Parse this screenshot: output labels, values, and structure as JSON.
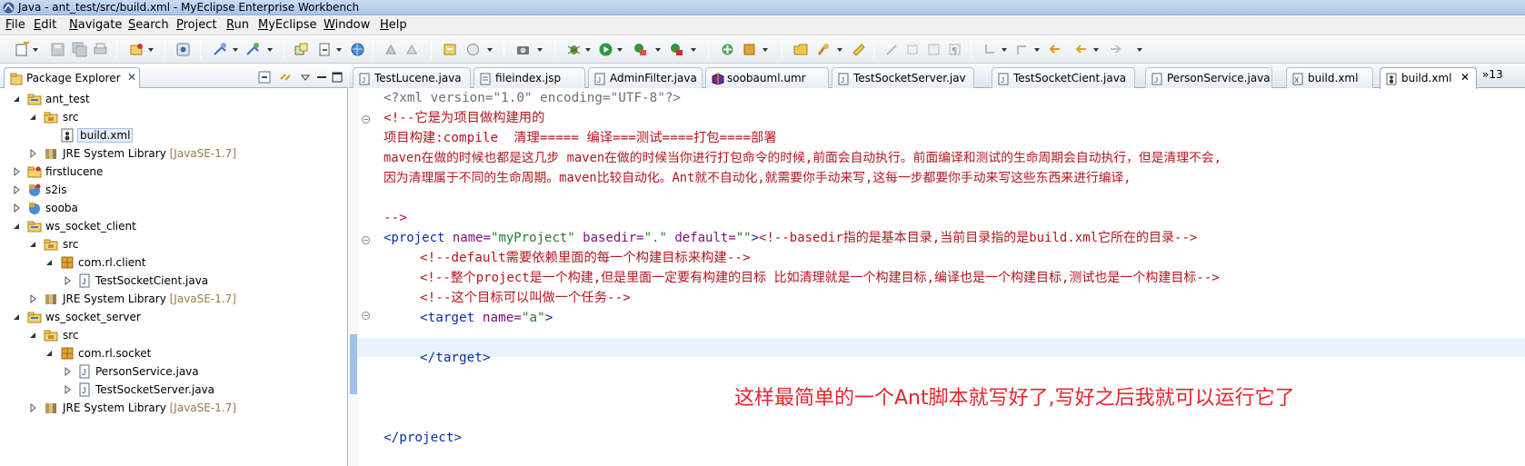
{
  "window": {
    "title": "Java - ant_test/src/build.xml - MyEclipse Enterprise Workbench"
  },
  "menu": [
    "File",
    "Edit",
    "Navigate",
    "Search",
    "Project",
    "Run",
    "MyEclipse",
    "Window",
    "Help"
  ],
  "package_explorer": {
    "title": "Package Explorer",
    "close": "✕",
    "tree": [
      {
        "label": "ant_test",
        "type": "project"
      },
      {
        "label": "src",
        "type": "folder"
      },
      {
        "label": "build.xml",
        "type": "xml"
      },
      {
        "label": "JRE System Library",
        "decoration": "[JavaSE-1.7]",
        "type": "library"
      },
      {
        "label": "firstlucene",
        "type": "project"
      },
      {
        "label": "s2is",
        "type": "project"
      },
      {
        "label": "sooba",
        "type": "project"
      },
      {
        "label": "ws_socket_client",
        "type": "project"
      },
      {
        "label": "src",
        "type": "folder"
      },
      {
        "label": "com.rl.client",
        "type": "package"
      },
      {
        "label": "TestSocketCient.java",
        "type": "java"
      },
      {
        "label": "JRE System Library",
        "decoration": "[JavaSE-1.7]",
        "type": "library"
      },
      {
        "label": "ws_socket_server",
        "type": "project"
      },
      {
        "label": "src",
        "type": "folder"
      },
      {
        "label": "com.rl.socket",
        "type": "package"
      },
      {
        "label": "PersonService.java",
        "type": "java"
      },
      {
        "label": "TestSocketServer.java",
        "type": "java"
      },
      {
        "label": "JRE System Library",
        "decoration": "[JavaSE-1.7]",
        "type": "library"
      }
    ]
  },
  "editor_tabs": [
    {
      "label": "TestLucene.java",
      "icon": "java-file-icon"
    },
    {
      "label": "fileindex.jsp",
      "icon": "jsp-file-icon"
    },
    {
      "label": "AdminFilter.java",
      "icon": "java-file-icon"
    },
    {
      "label": "soobauml.umr",
      "icon": "uml-file-icon"
    },
    {
      "label": "TestSocketServer.jav",
      "icon": "java-file-icon"
    },
    {
      "label": "TestSocketCient.java",
      "icon": "java-file-icon"
    },
    {
      "label": "PersonService.java",
      "icon": "java-file-icon"
    },
    {
      "label": "build.xml",
      "icon": "xml-file-icon"
    },
    {
      "label": "build.xml",
      "icon": "ant-file-icon",
      "active": true
    }
  ],
  "tab_overflow": "»13",
  "code": {
    "l1": "<?xml version=\"1.0\" encoding=\"UTF-8\"?>",
    "l2": "<!--它是为项目做构建用的",
    "l3": "项目构建:compile  清理===== 编译===测试====打包====部署",
    "l4": "maven在做的时候也都是这几步 maven在做的时候当你进行打包命令的时候,前面会自动执行。前面编译和测试的生命周期会自动执行，但是清理不会,",
    "l5": "因为清理属于不同的生命周期。maven比较自动化。Ant就不自动化,就需要你手动来写,这每一步都要你手动来写这些东西来进行编译,",
    "l6": "-->",
    "l7_tag": "<project",
    "l7_a1": " name=",
    "l7_v1": "\"myProject\"",
    "l7_a2": " basedir=",
    "l7_v2": "\".\"",
    "l7_a3": " default=",
    "l7_v3": "\"\"",
    "l7_close": ">",
    "l7_com": "<!--basedir指的是基本目录,当前目录指的是build.xml它所在的目录-->",
    "l8": "<!--default需要依赖里面的每一个构建目标来构建-->",
    "l9": "<!--整个project是一个构建,但是里面一定要有构建的目标 比如清理就是一个构建目标,编译也是一个构建目标,测试也是一个构建目标-->",
    "l10": "<!--这个目标可以叫做一个任务-->",
    "l11_tag": "<target",
    "l11_a": " name=",
    "l11_v": "\"a\"",
    "l11_close": ">",
    "l13": "</target>",
    "l17": "</project>"
  },
  "annotation": "这样最简单的一个Ant脚本就写好了,写好之后我就可以运行它了",
  "colors": {
    "tag": "#0b2ea8",
    "attribute": "#7a127a",
    "string": "#2a7a2a",
    "comment": "#b3181f",
    "annotation": "#e8252e"
  }
}
